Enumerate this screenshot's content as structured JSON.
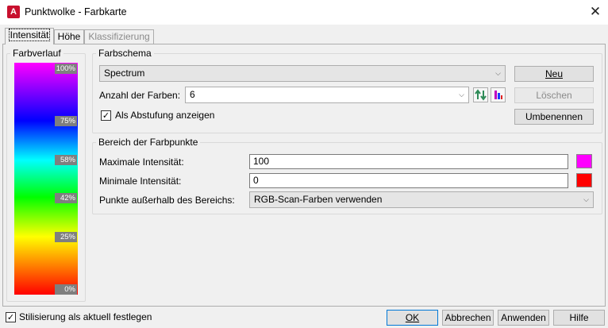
{
  "window": {
    "title": "Punktwolke - Farbkarte",
    "app_icon": "A",
    "close_glyph": "✕"
  },
  "tabs": [
    {
      "label": "Intensität",
      "active": true
    },
    {
      "label": "Höhe",
      "active": false
    },
    {
      "label": "Klassifizierung",
      "disabled": true
    }
  ],
  "gradient": {
    "title": "Farbverlauf",
    "stops": [
      "100%",
      "75%",
      "58%",
      "42%",
      "25%",
      "0%"
    ]
  },
  "scheme": {
    "title": "Farbschema",
    "selected": "Spectrum",
    "count_label": "Anzahl der Farben:",
    "count_value": "6",
    "show_steps_label": "Als Abstufung anzeigen",
    "show_steps_checked": true,
    "new_button": "Neu",
    "delete_button": "Löschen",
    "rename_button": "Umbenennen"
  },
  "range": {
    "title": "Bereich der Farbpunkte",
    "max_label": "Maximale Intensität:",
    "max_value": "100",
    "max_color": "#ff00ff",
    "min_label": "Minimale Intensität:",
    "min_value": "0",
    "min_color": "#ff0000",
    "outside_label": "Punkte außerhalb des Bereichs:",
    "outside_value": "RGB-Scan-Farben verwenden"
  },
  "footer": {
    "stylize_label": "Stilisierung als aktuell festlegen",
    "stylize_checked": true,
    "ok": "OK",
    "cancel": "Abbrechen",
    "apply": "Anwenden",
    "help": "Hilfe"
  }
}
